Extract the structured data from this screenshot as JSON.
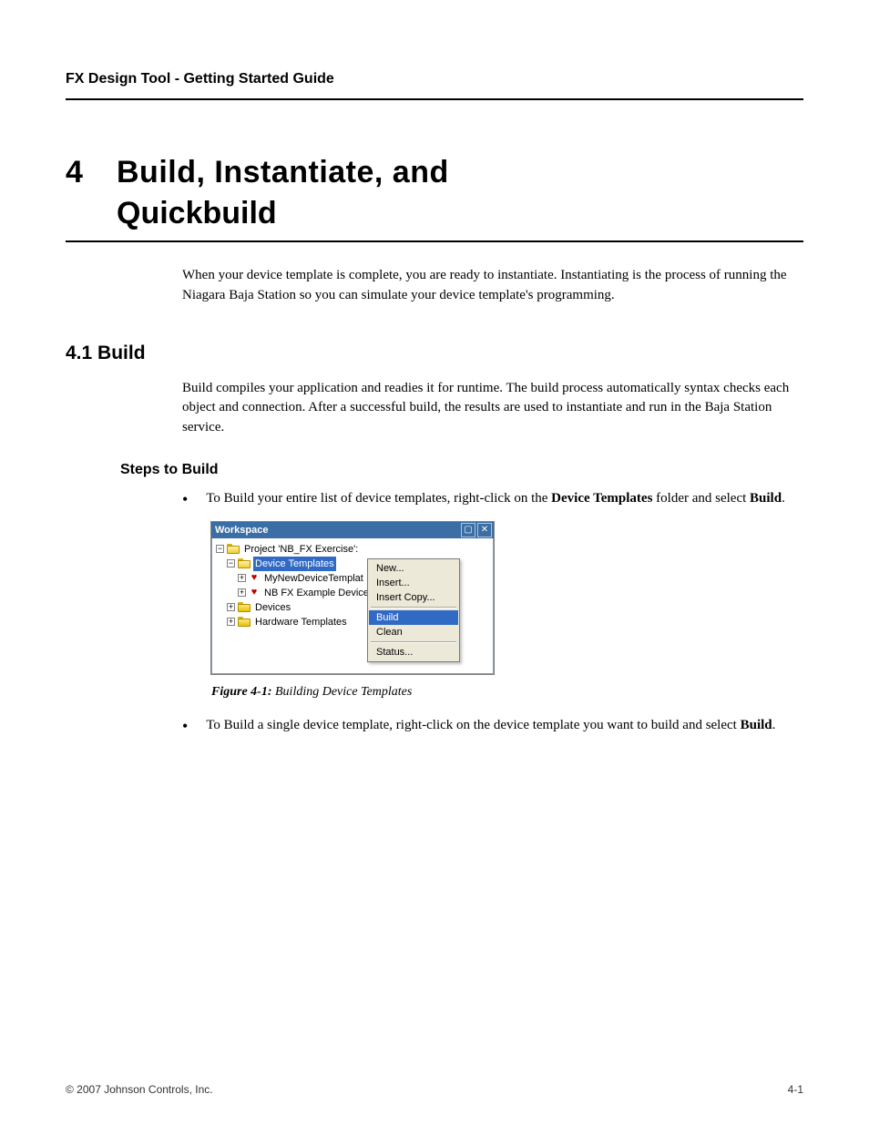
{
  "header": {
    "doc_title": "FX Design Tool - Getting Started Guide"
  },
  "chapter": {
    "number": "4",
    "title": "Build, Instantiate, and",
    "title_line2": "Quickbuild"
  },
  "intro": "When your device template is complete, you are ready to instantiate. Instantiating is the process of running the Niagara Baja Station so you can simulate your device template's programming.",
  "sec_build": {
    "heading": "4.1   Build",
    "para1": "Build compiles your application and readies it for runtime. The build process automatically syntax checks each object and connection. After a successful build, the results are used to instantiate and run in the Baja Station service.",
    "sub_heading": "Steps to Build",
    "bullet1_prefix": "To Build your entire list of device templates, right-click on the ",
    "bullet1_bold": "Device Templates",
    "bullet1_mid": " folder and select ",
    "bullet1_bold2": "Build",
    "bullet1_suffix": "."
  },
  "workspace": {
    "title": "Workspace",
    "tree": {
      "project": "Project 'NB_FX Exercise':",
      "device_templates": "Device Templates",
      "item1": "MyNewDeviceTemplat",
      "item2": "NB FX Example Device",
      "devices": "Devices",
      "hw_templates": "Hardware Templates"
    },
    "menu": {
      "new": "New...",
      "insert": "Insert...",
      "insert_copy": "Insert Copy...",
      "build": "Build",
      "clean": "Clean",
      "status": "Status..."
    }
  },
  "caption": {
    "prefix": "Figure 4-1:",
    "text": "  Building Device Templates"
  },
  "bullet2": {
    "prefix": "To Build a single device template, right-click on the device template you want to build and select ",
    "bold": "Build",
    "suffix": "."
  },
  "footer": {
    "copyright": "© 2007 Johnson Controls, Inc.",
    "page": "4-1"
  }
}
